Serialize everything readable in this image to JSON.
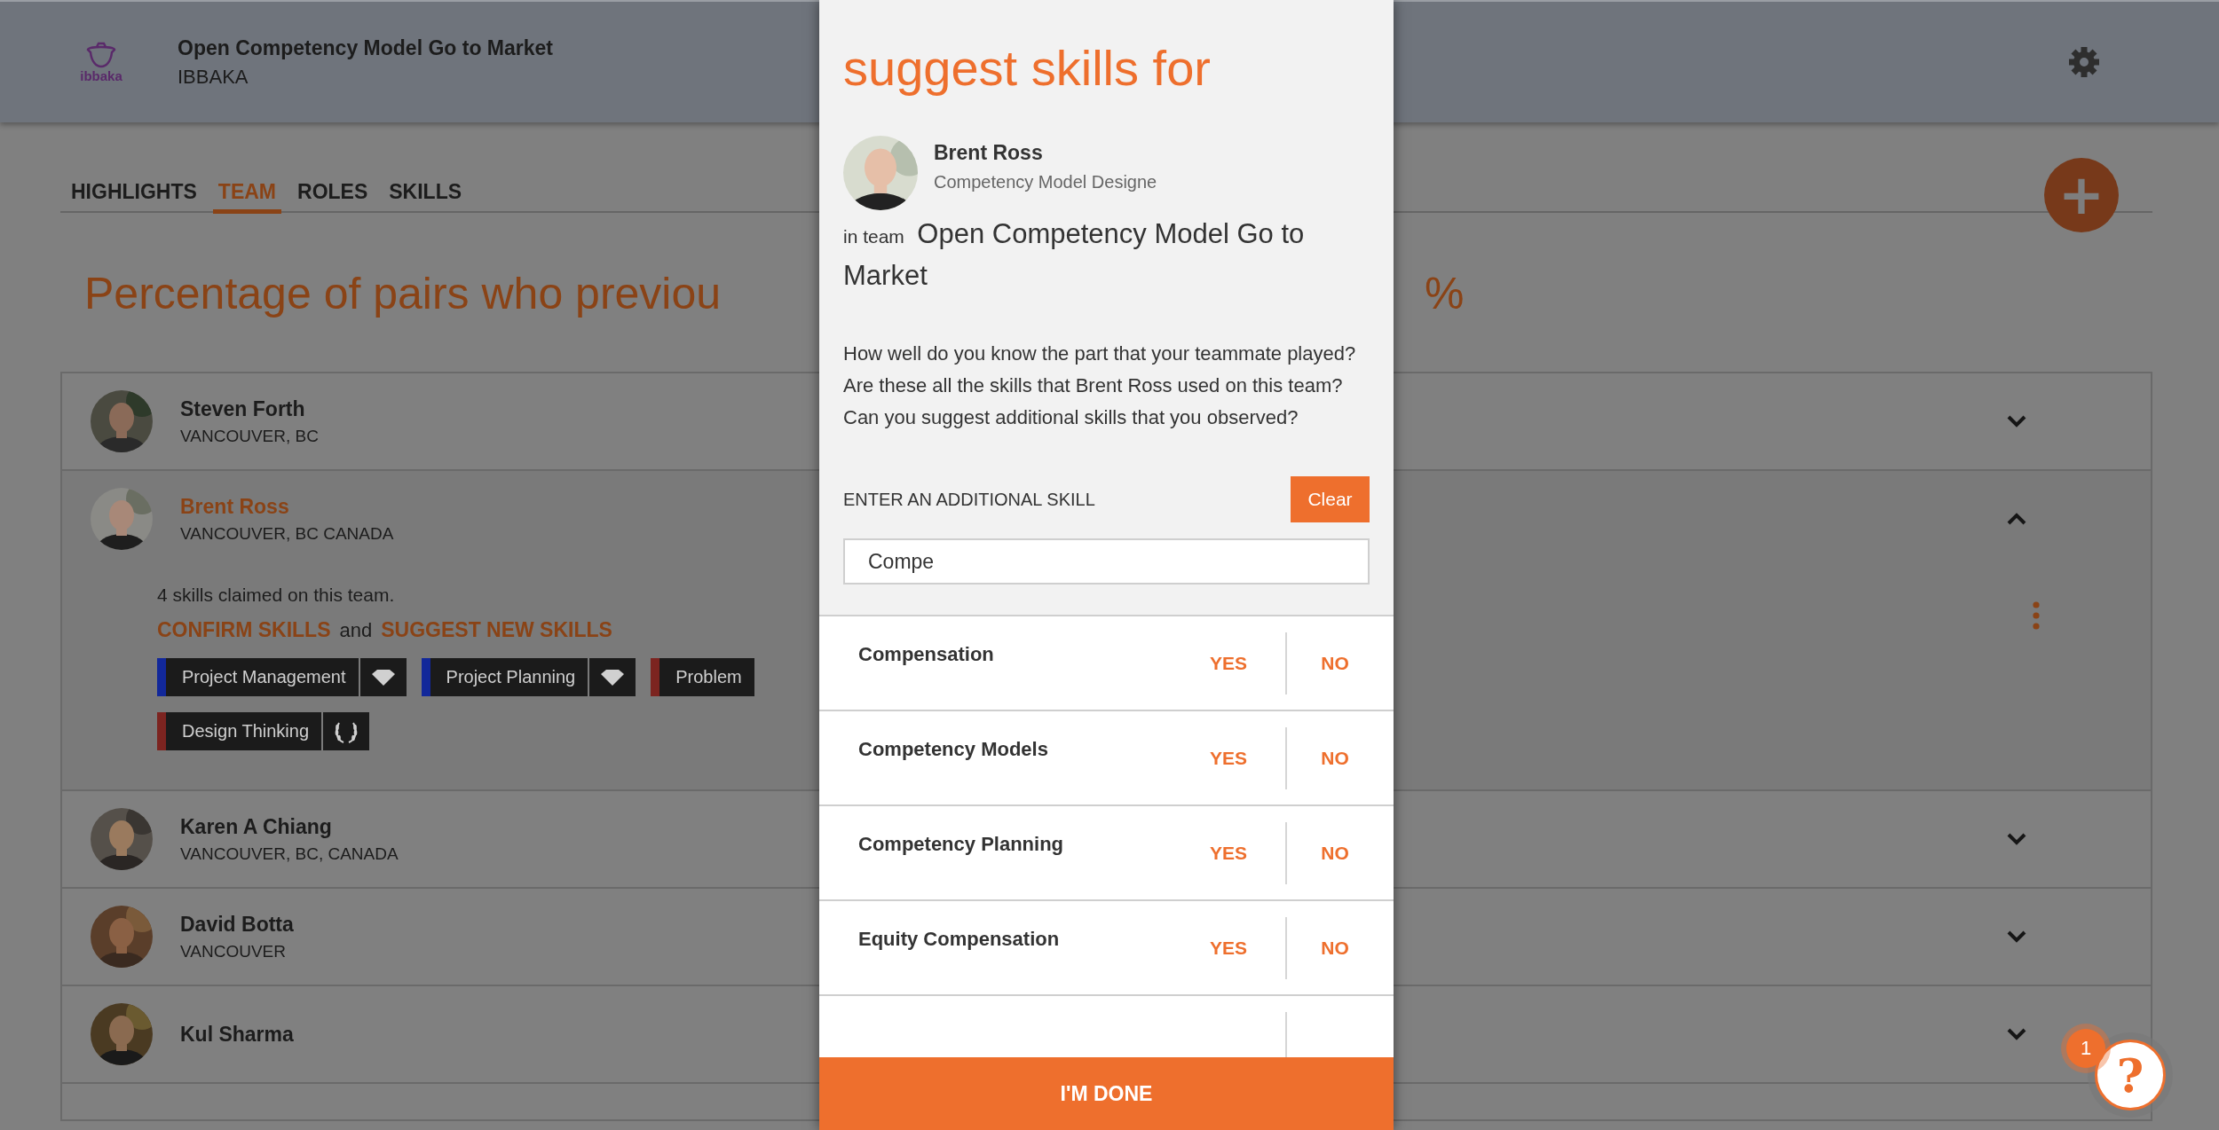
{
  "header": {
    "logo_text": "ibbaka",
    "title": "Open Competency Model Go to Market",
    "org": "IBBAKA"
  },
  "tabs": [
    {
      "label": "HIGHLIGHTS",
      "selected": false
    },
    {
      "label": "TEAM",
      "selected": true
    },
    {
      "label": "ROLES",
      "selected": false
    },
    {
      "label": "SKILLS",
      "selected": false
    }
  ],
  "add_button": {
    "label": "+"
  },
  "heading_fragments": [
    "Percentage of pairs who previou",
    "%"
  ],
  "members": [
    {
      "name": "Steven Forth",
      "location": "VANCOUVER, BC",
      "expanded": false
    },
    {
      "name": "Brent Ross",
      "location": "VANCOUVER, BC CANADA",
      "expanded": true,
      "details": {
        "claimed": "4 skills claimed on this team.",
        "confirm_link": "CONFIRM SKILLS",
        "joiner": "and",
        "suggest_link": "SUGGEST NEW SKILLS",
        "skill_rows": [
          [
            {
              "name": "Project Management",
              "color": "#12289a",
              "kind": "diamond"
            },
            {
              "name": "Project Planning",
              "color": "#12289a",
              "kind": "diamond"
            },
            {
              "name": "Problem",
              "color": "#7c2420",
              "kind": "plain"
            }
          ],
          [
            {
              "name": "Design Thinking",
              "color": "#7c2420",
              "kind": "laurel"
            }
          ]
        ]
      }
    },
    {
      "name": "Karen A Chiang",
      "location": "VANCOUVER, BC, CANADA",
      "expanded": false
    },
    {
      "name": "David Botta",
      "location": "VANCOUVER",
      "expanded": false
    },
    {
      "name": "Kul Sharma",
      "expanded": false
    }
  ],
  "help": {
    "label": "?",
    "badge": "1"
  },
  "dialog": {
    "title": "suggest skills for",
    "person": {
      "name": "Brent Ross",
      "role": "Competency Model Designe"
    },
    "team_prefix": "in team",
    "team_name": "Open Competency Model Go to Market",
    "question": "How well do you know the part that your teammate played? Are these all the skills that Brent Ross used on this team? Can you suggest additional skills that you observed?",
    "field_label": "ENTER AN ADDITIONAL SKILL",
    "clear_button": "Clear",
    "field_value": "Compe",
    "suggestions": [
      {
        "name": "Compensation",
        "yes": "YES",
        "no": "NO"
      },
      {
        "name": "Competency Models",
        "yes": "YES",
        "no": "NO"
      },
      {
        "name": "Competency Planning",
        "yes": "YES",
        "no": "NO"
      },
      {
        "name": "Equity Compensation",
        "yes": "YES",
        "no": "NO"
      }
    ],
    "done_button": "I'M DONE"
  }
}
